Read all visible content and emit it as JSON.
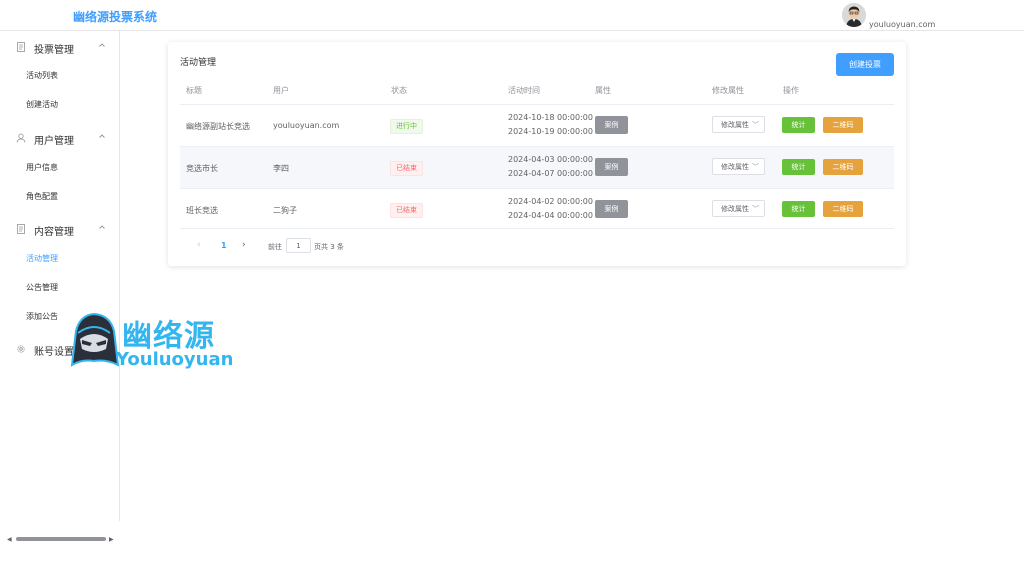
{
  "header": {
    "title": "幽络源投票系统",
    "username": "youluoyuan.com"
  },
  "sidebar": {
    "groups": [
      {
        "label": "投票管理",
        "icon": "document-icon",
        "items": [
          "活动列表",
          "创建活动"
        ]
      },
      {
        "label": "用户管理",
        "icon": "user-icon",
        "items": [
          "用户信息",
          "角色配置"
        ]
      },
      {
        "label": "内容管理",
        "icon": "document-icon",
        "items": [
          "活动管理",
          "公告管理",
          "添加公告"
        ],
        "active": "活动管理"
      },
      {
        "label": "账号设置",
        "icon": "gear-icon",
        "items": []
      }
    ]
  },
  "main": {
    "card_title": "活动管理",
    "create_label": "创建投票",
    "columns": [
      "标题",
      "用户",
      "状态",
      "活动时间",
      "属性",
      "修改属性",
      "操作"
    ],
    "rows": [
      {
        "title": "幽络源副站长竞选",
        "user": "youluoyuan.com",
        "status": "进行中",
        "start": "2024-10-18 00:00:00",
        "end": "2024-10-19 00:00:00",
        "attr": "案例",
        "modify": "修改属性",
        "stat": "统计",
        "qr": "二维码"
      },
      {
        "title": "竞选市长",
        "user": "李四",
        "status": "已结束",
        "start": "2024-04-03 00:00:00",
        "end": "2024-04-07 00:00:00",
        "attr": "案例",
        "modify": "修改属性",
        "stat": "统计",
        "qr": "二维码"
      },
      {
        "title": "班长竞选",
        "user": "二狗子",
        "status": "已结束",
        "start": "2024-04-02 00:00:00",
        "end": "2024-04-04 00:00:00",
        "attr": "案例",
        "modify": "修改属性",
        "stat": "统计",
        "qr": "二维码"
      }
    ],
    "pagination": {
      "current": "1",
      "goto_label": "前往",
      "page_input": "1",
      "total": "页共 3 条"
    }
  },
  "watermark": {
    "cn": "幽络源",
    "en": "Youluoyuan"
  },
  "colors": {
    "primary": "#409eff",
    "success": "#67c23a",
    "warning": "#e6a23c",
    "danger": "#f56c6c",
    "info": "#909399"
  }
}
